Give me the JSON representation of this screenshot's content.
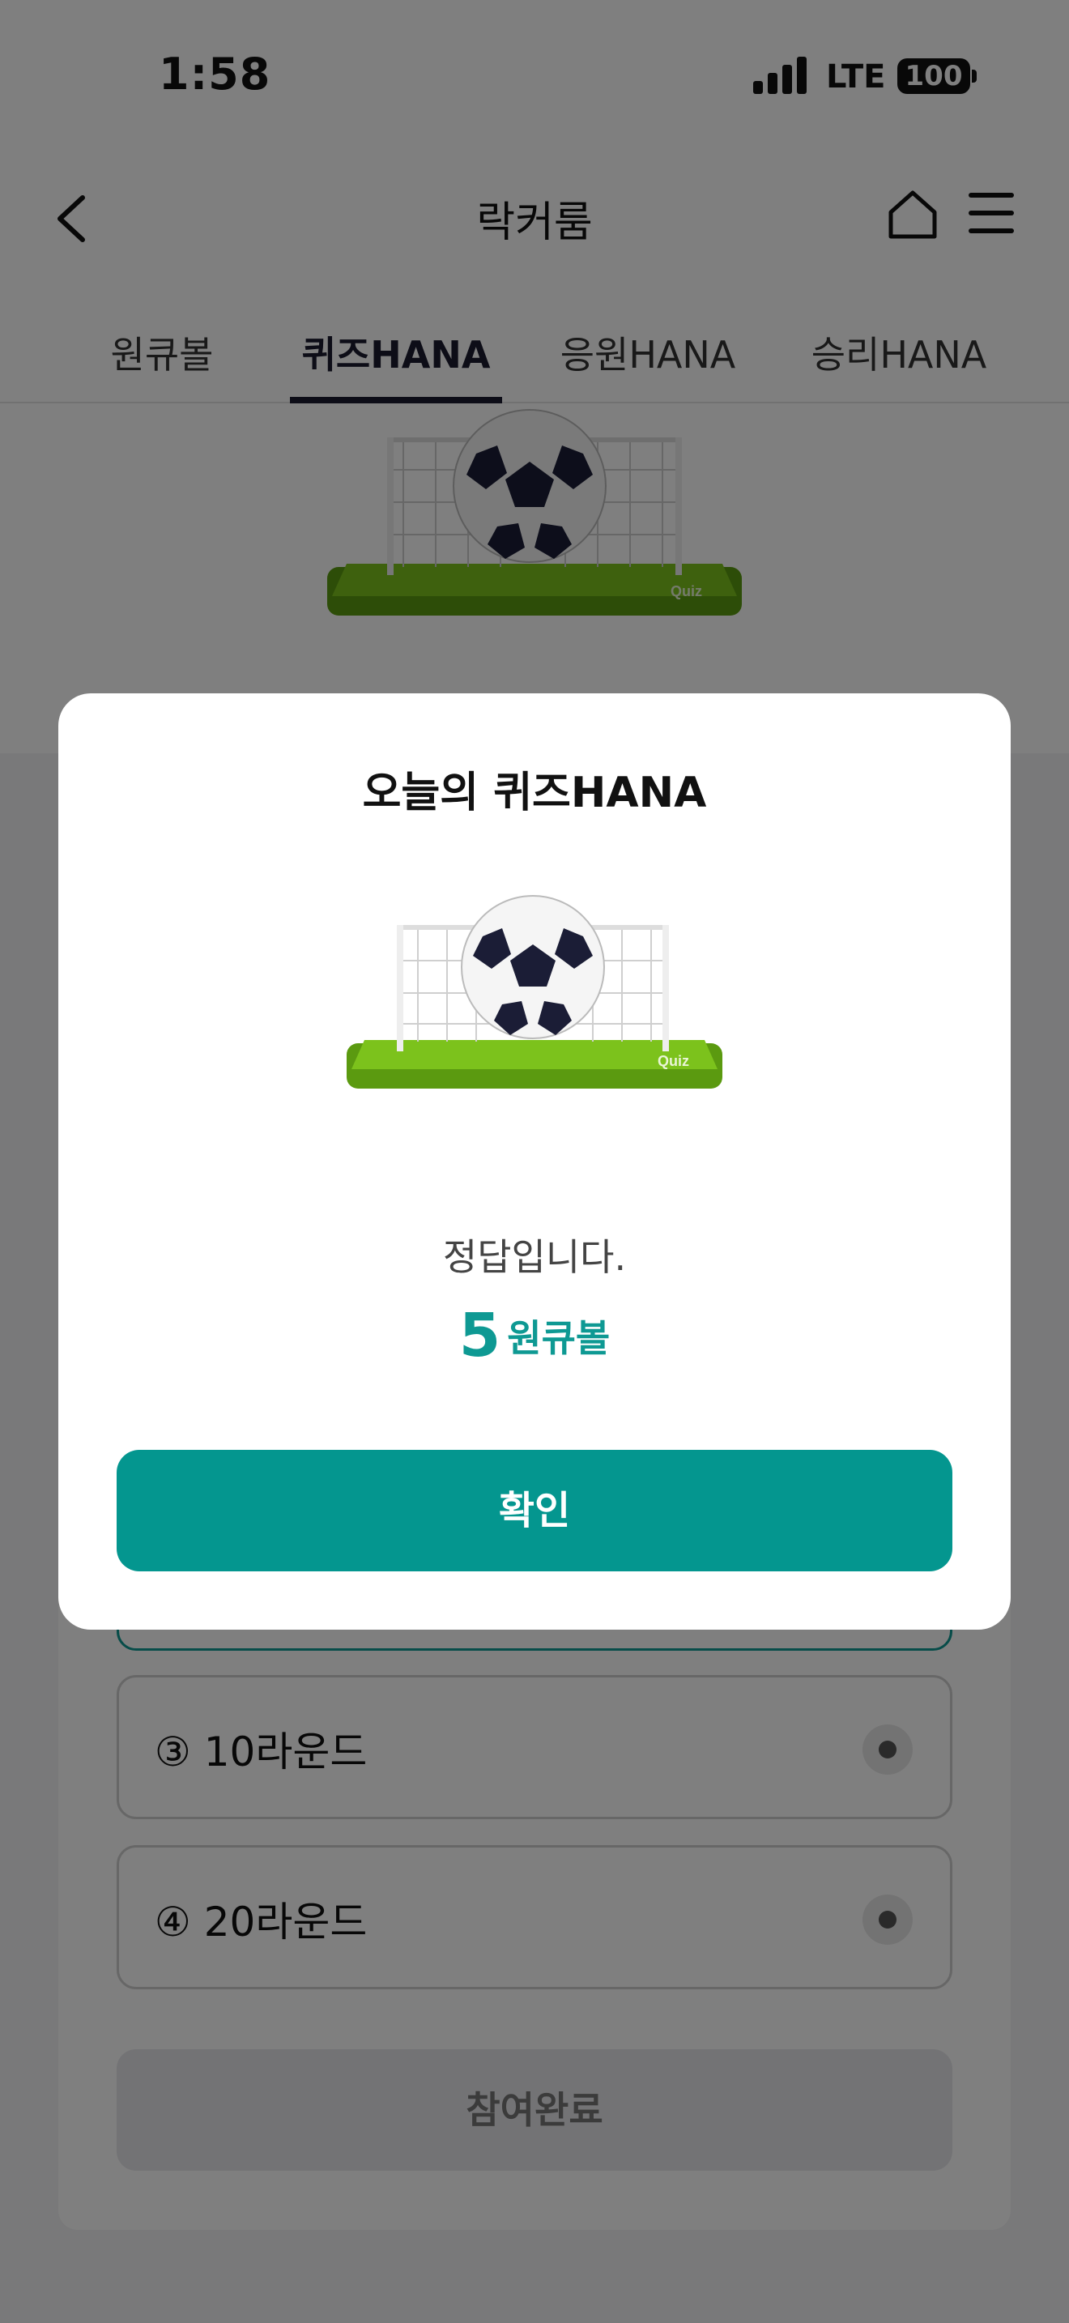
{
  "status_bar": {
    "time": "1:58",
    "network": "LTE",
    "battery": "100"
  },
  "header": {
    "title": "락커룸"
  },
  "tabs": [
    {
      "label": "원큐볼",
      "active": false
    },
    {
      "label": "퀴즈HANA",
      "active": true
    },
    {
      "label": "응원HANA",
      "active": false
    },
    {
      "label": "승리HANA",
      "active": false
    }
  ],
  "quiz_options": [
    {
      "label": "③ 10라운드"
    },
    {
      "label": "④ 20라운드"
    }
  ],
  "submit_label": "참여완료",
  "modal": {
    "title": "오늘의 퀴즈HANA",
    "badge_text": "Quiz",
    "result": "정답입니다.",
    "reward_amount": "5",
    "reward_unit": "원큐볼",
    "confirm_label": "확인"
  },
  "colors": {
    "accent": "#04968f",
    "tab_active": "#1a1b2e",
    "grass": "#7cc21c"
  }
}
